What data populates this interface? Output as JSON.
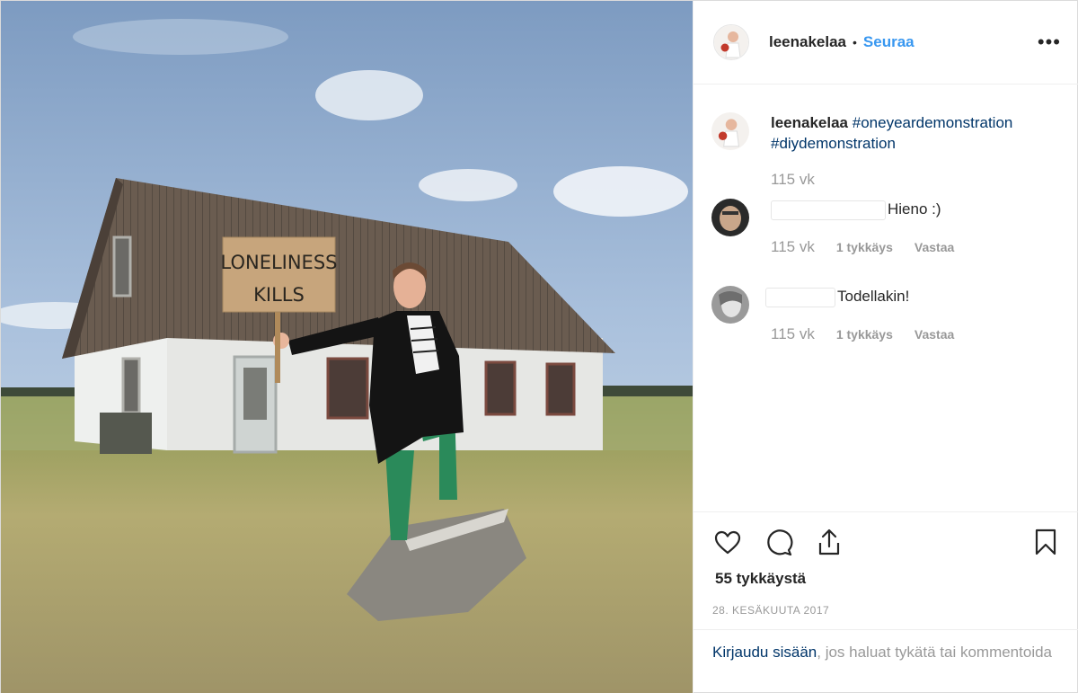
{
  "post": {
    "username": "leenakelaa",
    "follow_label": "Seuraa",
    "more_label": "•••",
    "caption": {
      "username": "leenakelaa",
      "hashtags": [
        "#oneyeardemonstration",
        "#diydemonstration"
      ],
      "time": "115 vk"
    },
    "sign_text": [
      "LONELINESS",
      "KILLS"
    ],
    "comments": [
      {
        "text": "Hieno :)",
        "time": "115 vk",
        "likes": "1 tykkäys",
        "reply": "Vastaa"
      },
      {
        "text": "Todellakin!",
        "time": "115 vk",
        "likes": "1 tykkäys",
        "reply": "Vastaa"
      }
    ],
    "icons": [
      "heart-icon",
      "comment-icon",
      "share-icon",
      "bookmark-icon"
    ],
    "like_count": "55 tykkäystä",
    "date": "28. KESÄKUUTA 2017",
    "login_link": "Kirjaudu sisään",
    "login_rest": ", jos haluat tykätä tai kommentoida",
    "colors": {
      "link": "#3897f0",
      "hashtag": "#003569",
      "muted": "#999999"
    }
  }
}
